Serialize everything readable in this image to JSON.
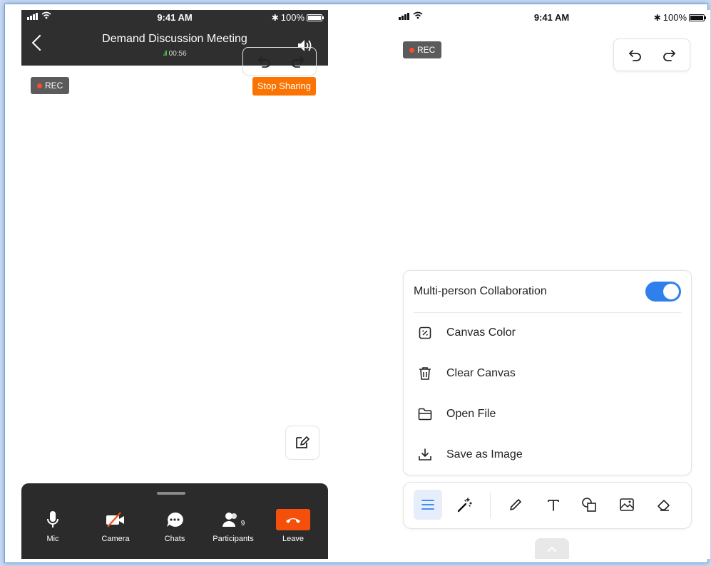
{
  "left": {
    "status": {
      "time": "9:41 AM",
      "battery": "100%"
    },
    "header": {
      "title": "Demand Discussion Meeting",
      "timer": "00:56"
    },
    "rec_label": "REC",
    "stop_sharing_label": "Stop Sharing",
    "toolbar": {
      "items": [
        {
          "label": "Mic",
          "icon": "mic-icon"
        },
        {
          "label": "Camera",
          "icon": "camera-off-icon"
        },
        {
          "label": "Chats",
          "icon": "chat-icon"
        },
        {
          "label": "Participants",
          "icon": "participants-icon",
          "badge": "9"
        },
        {
          "label": "Leave",
          "icon": "hang-up-icon"
        }
      ]
    }
  },
  "right": {
    "status": {
      "time": "9:41 AM",
      "battery": "100%"
    },
    "rec_label": "REC",
    "panel": {
      "collaboration_label": "Multi-person Collaboration",
      "collaboration_enabled": true,
      "items": [
        {
          "label": "Canvas Color",
          "icon": "canvas-color-icon"
        },
        {
          "label": "Clear Canvas",
          "icon": "trash-icon"
        },
        {
          "label": "Open File",
          "icon": "folder-icon"
        },
        {
          "label": "Save as Image",
          "icon": "download-icon"
        }
      ]
    },
    "tools": [
      "menu-icon",
      "magic-wand-icon",
      "pen-icon",
      "text-icon",
      "shapes-icon",
      "image-icon",
      "eraser-icon"
    ]
  },
  "colors": {
    "accent": "#2f80ed",
    "stop_sharing": "#fb7300",
    "leave": "#f4500c",
    "rec_dot": "#ff4b2b",
    "signal_green": "#3fc14b"
  }
}
